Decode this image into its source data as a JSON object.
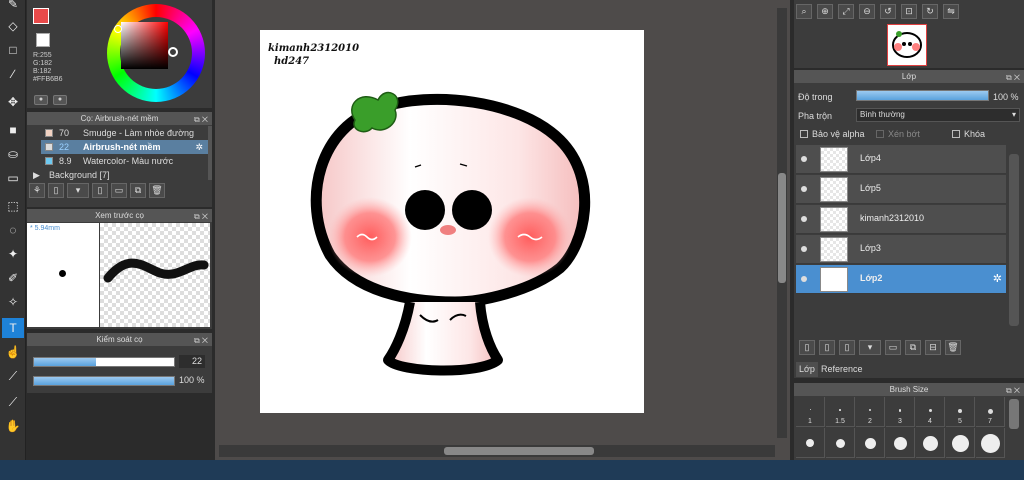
{
  "color": {
    "r_label": "R:255",
    "g_label": "G:182",
    "b_label": "B:182",
    "hex": "#FFB6B6",
    "accent": "#e84a4a"
  },
  "brush_panel": {
    "title": "Cọ: Airbrush-nét mềm",
    "items": [
      {
        "size": "70",
        "name": "Smudge - Làm nhòe đường",
        "swatch": "#f2d2c2"
      },
      {
        "size": "22",
        "name": "Airbrush-nét mềm",
        "swatch": "#dddddd"
      },
      {
        "size": "8.9",
        "name": "Watercolor- Màu nước",
        "swatch": "#6ec9f0"
      }
    ],
    "group": "Background [7]"
  },
  "preview_panel": {
    "title": "Xem trước cọ",
    "size": "5.94mm"
  },
  "control_panel": {
    "title": "Kiểm soát cọ",
    "size_value": "22",
    "size_fraction": 0.44,
    "opacity_value": "100 %",
    "opacity_fraction": 1.0
  },
  "canvas": {
    "text_line1": "kimanh2312010",
    "text_line2": "hd247"
  },
  "layer_panel": {
    "title": "Lớp",
    "opacity_label": "Độ trong",
    "opacity_value": "100 %",
    "opacity_fraction": 1.0,
    "blend_label": "Pha trộn",
    "blend_value": "Bình thường",
    "protect_alpha": "Bảo vệ alpha",
    "clipping": "Xén bớt",
    "lock": "Khóa",
    "layers": [
      {
        "name": "Lớp4",
        "selected": false
      },
      {
        "name": "Lớp5",
        "selected": false
      },
      {
        "name": "kimanh2312010",
        "selected": false
      },
      {
        "name": "Lớp3",
        "selected": false
      },
      {
        "name": "Lớp2",
        "selected": true
      }
    ],
    "tabs": [
      "Lớp",
      "Reference"
    ]
  },
  "brush_size_panel": {
    "title": "Brush Size",
    "sizes": [
      "1",
      "1.5",
      "2",
      "3",
      "4",
      "5",
      "7"
    ]
  }
}
